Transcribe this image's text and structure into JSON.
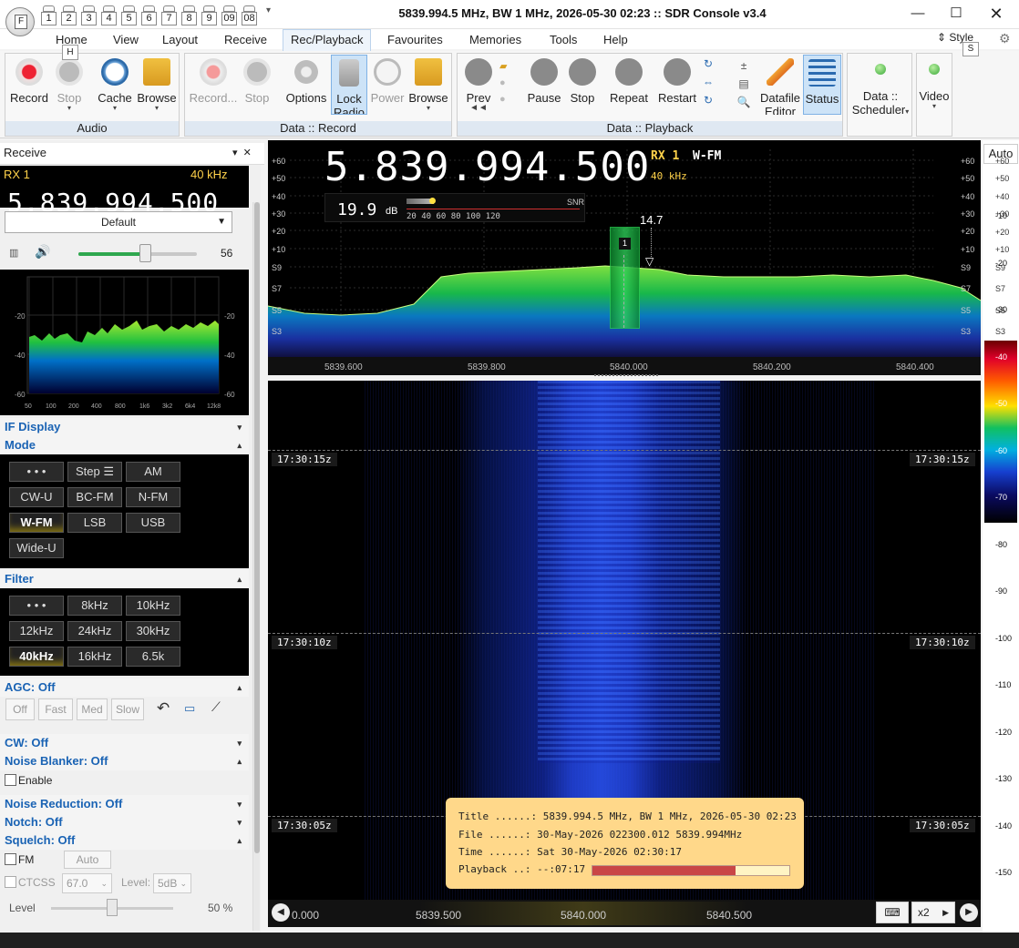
{
  "window": {
    "title": "5839.994.5 MHz, BW 1 MHz, 2026-05-30 02:23 :: SDR Console v3.4"
  },
  "app_icon": {
    "letter": "F"
  },
  "qat": {
    "keys": [
      "1",
      "2",
      "3",
      "4",
      "5",
      "6",
      "7",
      "8",
      "9",
      "09",
      "08"
    ]
  },
  "keytips": {
    "home": "H",
    "style": "S"
  },
  "menu": {
    "tabs": [
      "Home",
      "View",
      "Layout",
      "Receive",
      "Rec/Playback",
      "Favourites",
      "Memories",
      "Tools",
      "Help"
    ],
    "active": "Rec/Playback",
    "style": "Style"
  },
  "ribbon": {
    "audio": {
      "label": "Audio",
      "buttons": [
        "Record",
        "Stop",
        "Cache",
        "Browse"
      ]
    },
    "data_record": {
      "label": "Data :: Record",
      "buttons": [
        "Record...",
        "Stop",
        "Options",
        "Lock Radio",
        "Power",
        "Browse"
      ]
    },
    "data_playback": {
      "label": "Data :: Playback",
      "buttons": [
        "Prev",
        "Pause",
        "Stop",
        "Repeat",
        "Restart",
        "Datafile Editor",
        "Status"
      ]
    },
    "extra": {
      "buttons": [
        "Data :: Scheduler",
        "Video"
      ]
    }
  },
  "receive": {
    "header": "Receive",
    "rx": "RX 1",
    "bw": "40 kHz",
    "freq": "5.839.994.500",
    "profile": "Default",
    "volume": 56,
    "volume_label": "56"
  },
  "audio_spectrum": {
    "y_left": [
      "-20",
      "-40",
      "-60"
    ],
    "y_right": [
      "-20",
      "-40",
      "-60"
    ],
    "x": [
      "50",
      "100",
      "200",
      "400",
      "800",
      "1k6",
      "3k2",
      "6k4",
      "12k8"
    ]
  },
  "sections": {
    "if_display": "IF Display",
    "mode": "Mode",
    "filter": "Filter",
    "agc": "AGC: Off",
    "cw": "CW: Off",
    "noise_blanker": "Noise Blanker: Off",
    "enable": "Enable",
    "noise_reduction": "Noise Reduction: Off",
    "notch": "Notch: Off",
    "squelch": "Squelch: Off"
  },
  "modes": [
    "• • •",
    "Step ☰",
    "AM",
    "CW-U",
    "BC-FM",
    "N-FM",
    "W-FM",
    "LSB",
    "USB",
    "Wide-U"
  ],
  "filters": [
    "• • •",
    "8kHz",
    "10kHz",
    "12kHz",
    "24kHz",
    "30kHz",
    "40kHz",
    "16kHz",
    "6.5k"
  ],
  "agc_buttons": [
    "Off",
    "Fast",
    "Med",
    "Slow"
  ],
  "squelch": {
    "fm": "FM",
    "auto": "Auto",
    "ctcss": "CTCSS",
    "ctcss_val": "67.0",
    "level_lbl": "Level:",
    "level_val": "5dB"
  },
  "level": {
    "label": "Level",
    "value": "50 %",
    "fraction": 0.5
  },
  "spectrum": {
    "freq": "5.839.994.500",
    "rx": "RX 1",
    "mode": "W-FM",
    "bw": "40 kHz",
    "db": "19.9",
    "db_unit": "dB",
    "snr_label": "SNR",
    "snr_scale": "20  40  60  80  100 120",
    "peak": "14.7",
    "vfo_num": "1",
    "y_labels": [
      "+60",
      "+50",
      "+40",
      "+30",
      "+20",
      "+10",
      "S9",
      "S7",
      "S5",
      "S3"
    ],
    "x_labels": [
      "5839.600",
      "5839.800",
      "5840.000",
      "5840.200",
      "5840.400"
    ]
  },
  "waterfall": {
    "times": [
      "17:30:15z",
      "17:30:10z",
      "17:30:05z"
    ],
    "x_labels": [
      "0.000",
      "5839.500",
      "5840.000",
      "5840.500"
    ],
    "zoom": "x2"
  },
  "right_scale": {
    "auto": "Auto",
    "top": [
      "+60",
      "+50",
      "+40",
      "+30",
      "+20",
      "+10",
      "S9",
      "S7",
      "S5",
      "S3"
    ],
    "values": [
      "-10",
      "-20",
      "-30",
      "-40",
      "-50",
      "-60",
      "-70",
      "-80",
      "-90",
      "-100",
      "-110",
      "-120",
      "-130",
      "-140",
      "-150"
    ]
  },
  "info": {
    "title_k": "Title ......:",
    "title": "5839.994.5 MHz, BW 1 MHz, 2026-05-30 02:23",
    "file_k": "File ......:",
    "file": "30-May-2026 022300.012 5839.994MHz",
    "time_k": "Time ......:",
    "time": "Sat 30-May-2026 02:30:17",
    "play_k": "Playback ..:",
    "play": "--:07:17",
    "progress": 0.72
  },
  "colors": {
    "accent": "#1a63b4",
    "ribbon_tab": "#dfe8f2",
    "selected": "#cde3f7",
    "spectrum_green": "#2fd05a",
    "info_bg": "#ffd88a",
    "progress": "#c94646"
  }
}
